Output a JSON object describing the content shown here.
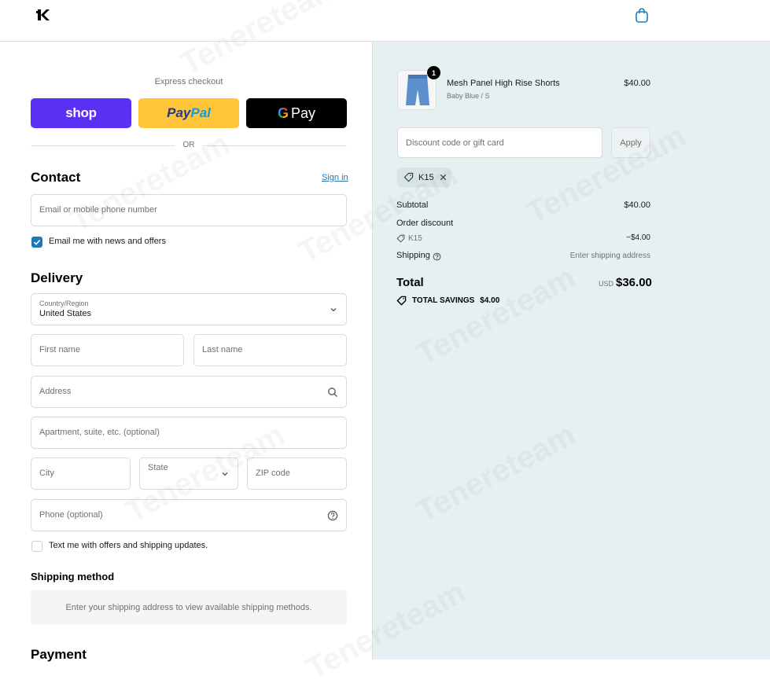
{
  "header": {
    "logo": "K"
  },
  "express": {
    "title": "Express checkout",
    "shop_label": "shop",
    "paypal_a": "Pay",
    "paypal_b": "Pal",
    "gpay_g": "G",
    "gpay_label": "Pay",
    "or": "OR"
  },
  "contact": {
    "title": "Contact",
    "sign_in": "Sign in",
    "email_placeholder": "Email or mobile phone number",
    "news_label": "Email me with news and offers",
    "news_checked": true
  },
  "delivery": {
    "title": "Delivery",
    "country_label": "Country/Region",
    "country_value": "United States",
    "first_name": "First name",
    "last_name": "Last name",
    "address": "Address",
    "apartment": "Apartment, suite, etc. (optional)",
    "city": "City",
    "state": "State",
    "zip": "ZIP code",
    "phone": "Phone (optional)",
    "sms_label": "Text me with offers and shipping updates.",
    "sms_checked": false
  },
  "shipping_method": {
    "title": "Shipping method",
    "message": "Enter your shipping address to view available shipping methods."
  },
  "payment": {
    "title": "Payment"
  },
  "summary": {
    "item": {
      "name": "Mesh Panel High Rise Shorts",
      "variant": "Baby Blue / S",
      "price": "$40.00",
      "qty": "1"
    },
    "discount_placeholder": "Discount code or gift card",
    "apply": "Apply",
    "code_chip": "K15",
    "subtotal_label": "Subtotal",
    "subtotal_value": "$40.00",
    "order_discount_label": "Order discount",
    "discount_code": "K15",
    "discount_value": "−$4.00",
    "shipping_label": "Shipping",
    "shipping_value": "Enter shipping address",
    "total_label": "Total",
    "currency": "USD",
    "total_value": "$36.00",
    "savings_label": "TOTAL SAVINGS",
    "savings_value": "$4.00"
  },
  "watermark": "Tenereteam",
  "colors": {
    "shop": "#5a31f4",
    "paypal": "#ffc439",
    "gpay": "#000000",
    "accent": "#197bbd",
    "summary_bg": "#e6f0f2"
  }
}
